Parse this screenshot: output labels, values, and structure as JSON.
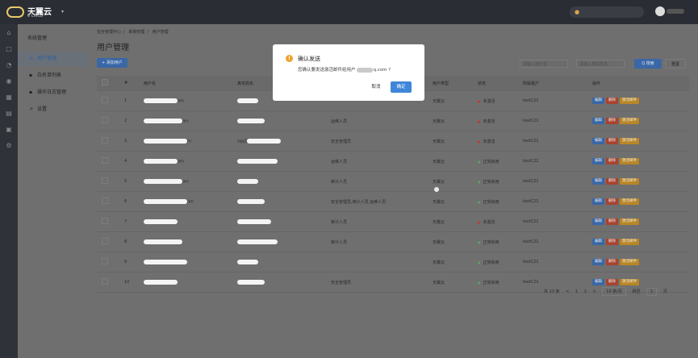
{
  "topbar": {
    "brand": "天翼云",
    "brand_sub": "e Cloud",
    "caret": "▾"
  },
  "sidebar": {
    "title": "系统管理",
    "items": [
      {
        "label": "用户管理",
        "icon": "user-icon"
      },
      {
        "label": "白名单列表",
        "icon": "list-icon"
      },
      {
        "label": "操作日志管理",
        "icon": "log-icon"
      },
      {
        "label": "设置",
        "icon": "wrench-icon"
      }
    ]
  },
  "breadcrumb": [
    "安全管理中心",
    "系统管理",
    "用户管理"
  ],
  "page_title": "用户管理",
  "toolbar": {
    "add_label": "+ 添加用户",
    "search_label": "Q 搜索",
    "reset_label": "重置"
  },
  "filters": {
    "user_placeholder": "请输入用户名",
    "name_placeholder": "请输入真实姓名"
  },
  "table": {
    "headers": [
      "#",
      "用户名",
      "真实姓名",
      "",
      "用户类型",
      "状态",
      "所属租户",
      "操作"
    ],
    "rows": [
      {
        "idx": "1",
        "user_tail": "om",
        "real": "",
        "role": "",
        "utype": "天翼云",
        "status": "未激活",
        "status_color": "#c0392b",
        "tenant": "testC21"
      },
      {
        "idx": "2",
        "user_tail": "om",
        "real": "",
        "role": "运维人员",
        "utype": "天翼云",
        "status": "未激活",
        "status_color": "#c0392b",
        "tenant": "testC21"
      },
      {
        "idx": "3",
        "user_tail": "m",
        "real": "zqq1",
        "role": "安全管理员",
        "utype": "天翼云",
        "status": "未激活",
        "status_color": "#c0392b",
        "tenant": "testC21"
      },
      {
        "idx": "4",
        "user_tail": "om",
        "real": "",
        "role": "运维人员",
        "utype": "天翼云",
        "status": "正常启用",
        "status_color": "#5aa36a",
        "tenant": "testC21"
      },
      {
        "idx": "5",
        "user_tail": "om",
        "real": "",
        "role": "审计人员",
        "utype": "天翼云",
        "status": "正常启用",
        "status_color": "#5aa36a",
        "tenant": "testC21"
      },
      {
        "idx": "6",
        "user_tail": "om",
        "real": "",
        "role": "安全管理员,审计人员,运维人员",
        "utype": "天翼云",
        "status": "正常启用",
        "status_color": "#5aa36a",
        "tenant": "testC21"
      },
      {
        "idx": "7",
        "user_tail": "",
        "real": "",
        "role": "审计人员",
        "utype": "天翼云",
        "status": "未激活",
        "status_color": "#c0392b",
        "tenant": "testC21"
      },
      {
        "idx": "8",
        "user_tail": "",
        "real": "",
        "role": "审计人员",
        "utype": "天翼云",
        "status": "正常启用",
        "status_color": "#5aa36a",
        "tenant": "testC21"
      },
      {
        "idx": "9",
        "user_tail": "",
        "real": "",
        "role": "",
        "utype": "天翼云",
        "status": "正常启用",
        "status_color": "#5aa36a",
        "tenant": "testC21"
      },
      {
        "idx": "10",
        "user_tail": "",
        "real": "",
        "role": "安全管理员",
        "utype": "天翼云",
        "status": "正常启用",
        "status_color": "#5aa36a",
        "tenant": "testC21"
      }
    ],
    "actions": {
      "edit": "编辑",
      "delete": "删除",
      "send": "激活邮件"
    }
  },
  "pager": {
    "total": "共 13 条",
    "prev": "<",
    "p1": "1",
    "p2": "2",
    ">": ">",
    "next": ">",
    "size": "10 条/页",
    "goto": "跳至",
    "page": "1",
    "unit": "页"
  },
  "modal": {
    "title": "确认发送",
    "body_pre": "您确认要发送激活邮件给用户",
    "body_post": "q.com ?",
    "cancel": "取消",
    "ok": "确定",
    "icon": "!"
  }
}
